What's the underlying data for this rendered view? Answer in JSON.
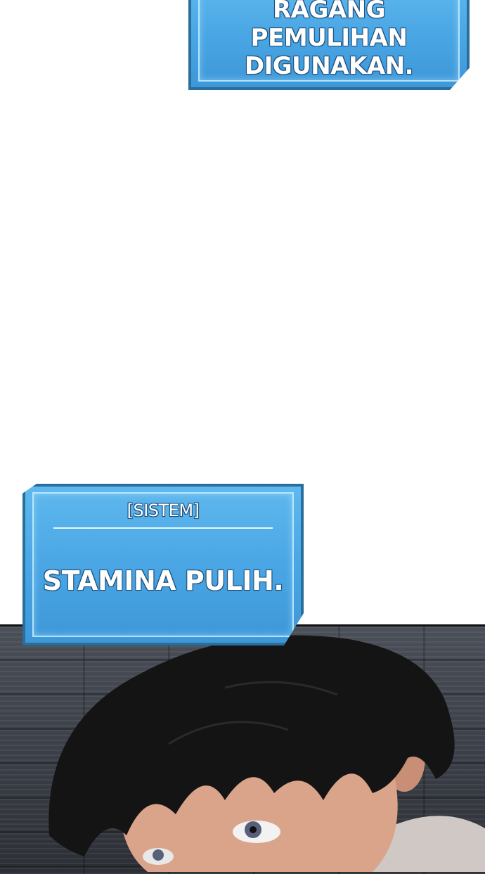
{
  "top_box": {
    "lines": [
      "RAGANG",
      "PEMULIHAN",
      "DIGUNAKAN."
    ]
  },
  "bottom_box": {
    "header": "[SISTEM]",
    "message": "STAMINA PULIH."
  },
  "colors": {
    "box_fill": "#4aa6e4",
    "box_border": "#2a6f9c",
    "hair": "#141414",
    "skin": "#d9a48a"
  }
}
